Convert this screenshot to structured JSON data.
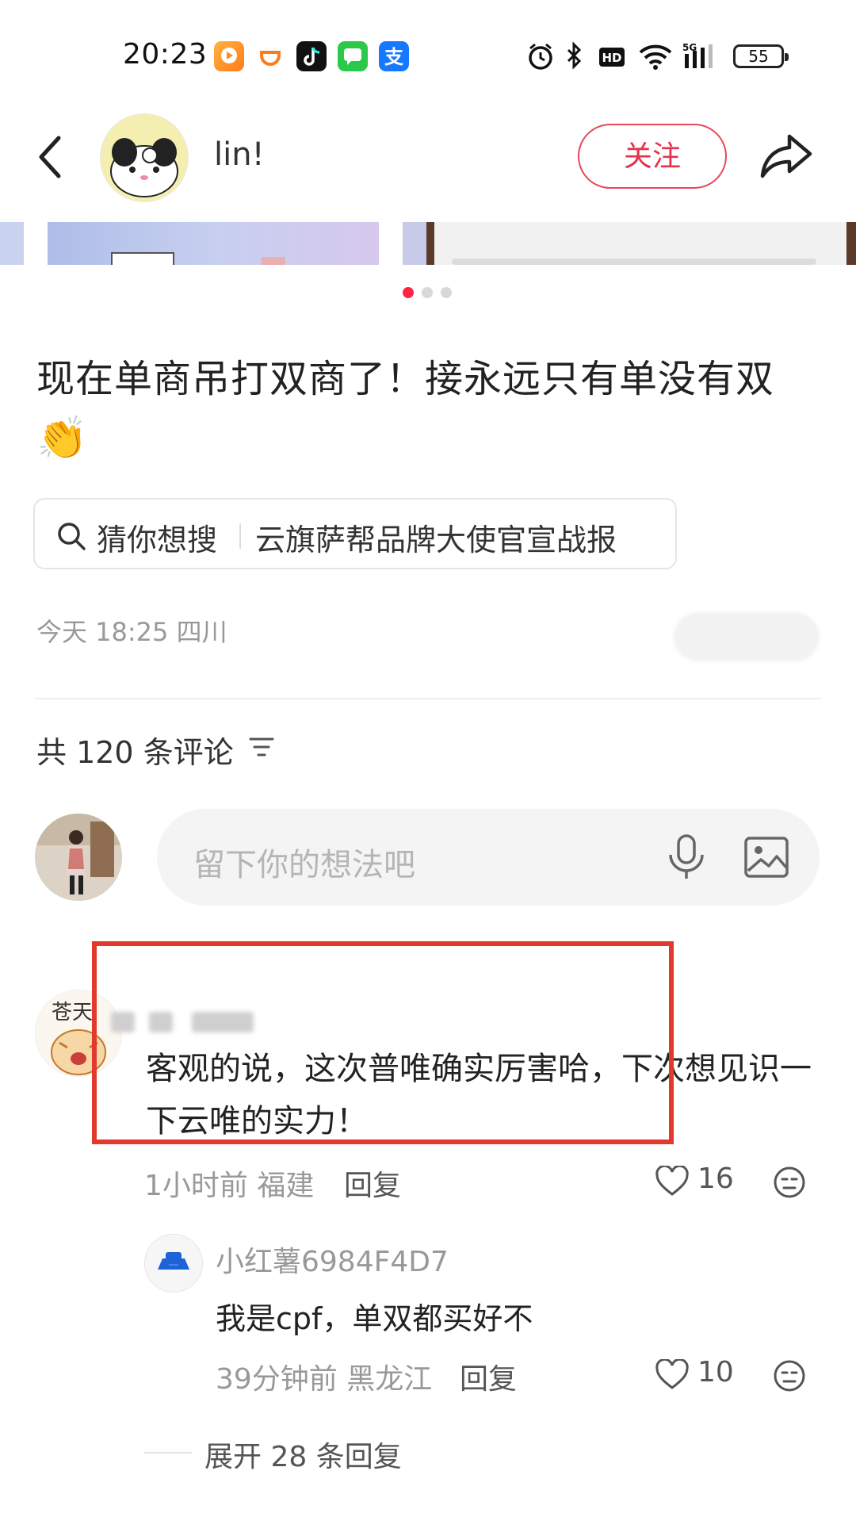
{
  "status_bar": {
    "time": "20:23",
    "battery": "55",
    "app_icons": [
      "video-app-icon",
      "didi-icon",
      "tiktok-icon",
      "messages-icon",
      "alipay-icon"
    ],
    "system_icons": [
      "alarm-icon",
      "bluetooth-icon",
      "hd-icon",
      "wifi-icon",
      "5g-signal-icon",
      "battery-icon"
    ]
  },
  "header": {
    "author_name": "lin!",
    "follow_label": "关注"
  },
  "carousel": {
    "pages": 3,
    "active_page": 1
  },
  "post": {
    "title": "现在单商吊打双商了！接永远只有单没有双",
    "emoji": "👏",
    "search_chip": {
      "label": "猜你想搜",
      "text": "云旗萨帮品牌大使官宣战报"
    },
    "meta": "今天 18:25 四川"
  },
  "comments_header": {
    "label": "共 120 条评论"
  },
  "comment_input": {
    "placeholder": "留下你的想法吧"
  },
  "comments": [
    {
      "text": "客观的说，这次普唯确实厉害哈，下次想见识一下云唯的实力！",
      "meta": "1小时前 福建",
      "reply_label": "回复",
      "likes": "16",
      "replies": [
        {
          "author": "小红薯6984F4D7",
          "text": "我是cpf，单双都买好不",
          "meta": "39分钟前 黑龙江",
          "reply_label": "回复",
          "likes": "10"
        }
      ],
      "expand_label": "展开 28 条回复"
    }
  ],
  "colors": {
    "accent_red": "#e8304a",
    "highlight_box": "#e1392e",
    "muted_text": "#999999"
  }
}
